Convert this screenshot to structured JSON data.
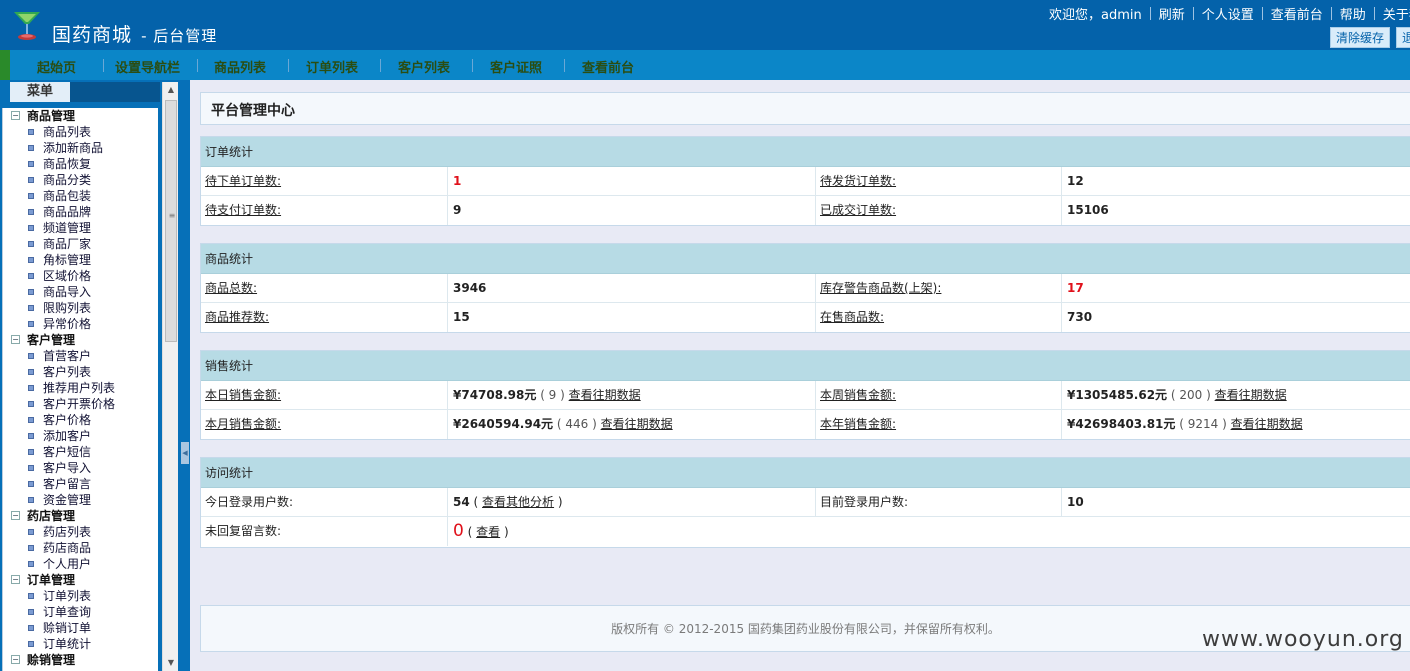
{
  "header": {
    "logo_text": "国药商城",
    "logo_sub": "- 后台管理",
    "welcome": "欢迎您，admin",
    "links": [
      "刷新",
      "个人设置",
      "查看前台",
      "帮助",
      "关于我"
    ],
    "buttons": [
      "清除缓存",
      "退出"
    ]
  },
  "nav": {
    "items": [
      "起始页",
      "设置导航栏",
      "商品列表",
      "订单列表",
      "客户列表",
      "客户证照",
      "查看前台"
    ]
  },
  "sidebar": {
    "tab_label": "菜单",
    "groups": [
      {
        "title": "商品管理",
        "items": [
          "商品列表",
          "添加新商品",
          "商品恢复",
          "商品分类",
          "商品包装",
          "商品品牌",
          "频道管理",
          "商品厂家",
          "角标管理",
          "区域价格",
          "商品导入",
          "限购列表",
          "异常价格"
        ]
      },
      {
        "title": "客户管理",
        "items": [
          "首营客户",
          "客户列表",
          "推荐用户列表",
          "客户开票价格",
          "客户价格",
          "添加客户",
          "客户短信",
          "客户导入",
          "客户留言",
          "资金管理"
        ]
      },
      {
        "title": "药店管理",
        "items": [
          "药店列表",
          "药店商品",
          "个人用户"
        ]
      },
      {
        "title": "订单管理",
        "items": [
          "订单列表",
          "订单查询",
          "赊销订单",
          "订单统计"
        ]
      },
      {
        "title": "赊销管理",
        "items": []
      }
    ]
  },
  "main": {
    "title": "平台管理中心",
    "order_stats": {
      "header": "订单统计",
      "rows": [
        {
          "l1": "待下单订单数:",
          "v1": "1",
          "l2": "待发货订单数:",
          "v2": "12"
        },
        {
          "l1": "待支付订单数:",
          "v1": "9",
          "l2": "已成交订单数:",
          "v2": "15106"
        }
      ]
    },
    "product_stats": {
      "header": "商品统计",
      "rows": [
        {
          "l1": "商品总数:",
          "v1": "3946",
          "l2": "库存警告商品数(上架):",
          "v2": "17"
        },
        {
          "l1": "商品推荐数:",
          "v1": "15",
          "l2": "在售商品数:",
          "v2": "730"
        }
      ]
    },
    "sales_stats": {
      "header": "销售统计",
      "rows": [
        {
          "l1": "本日销售金额:",
          "amt1": "¥74708.98元",
          "cnt1": "( 9 )",
          "link1": "查看往期数据",
          "l2": "本周销售金额:",
          "amt2": "¥1305485.62元",
          "cnt2": "( 200 )",
          "link2": "查看往期数据"
        },
        {
          "l1": "本月销售金额:",
          "amt1": "¥2640594.94元",
          "cnt1": "( 446 )",
          "link1": "查看往期数据",
          "l2": "本年销售金额:",
          "amt2": "¥42698403.81元",
          "cnt2": "( 9214 )",
          "link2": "查看往期数据"
        }
      ]
    },
    "visit_stats": {
      "header": "访问统计",
      "login_today_label": "今日登录用户数:",
      "login_today_value": "54",
      "login_today_open": "(",
      "login_today_link": "查看其他分析",
      "login_today_close": ")",
      "current_login_label": "目前登录用户数:",
      "current_login_value": "10",
      "unreplied_label": "未回复留言数:",
      "unreplied_value": "0",
      "unreplied_open": "(",
      "unreplied_link": "查看",
      "unreplied_close": ")"
    },
    "footer": "版权所有 © 2012-2015 国药集团药业股份有限公司，并保留所有权利。"
  },
  "watermark": "www.wooyun.org",
  "colors": {
    "topbar": "#0462aa",
    "navbar": "#0b86c8",
    "panel_header": "#b7dbe5",
    "alert_red": "#e0101a"
  }
}
